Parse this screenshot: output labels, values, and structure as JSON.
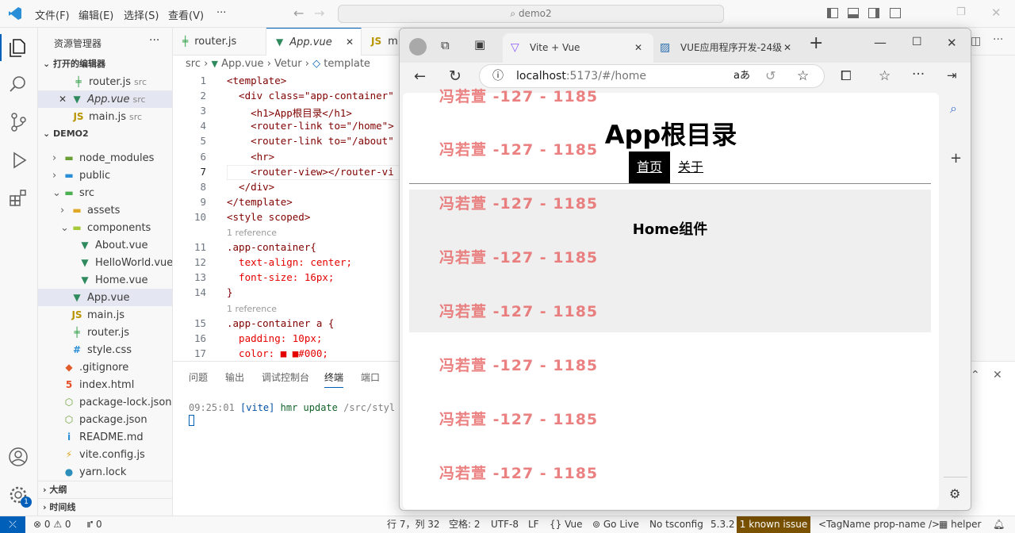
{
  "menu": {
    "file": "文件(F)",
    "edit": "编辑(E)",
    "select": "选择(S)",
    "view": "查看(V)",
    "more": "···"
  },
  "search": {
    "text": "demo2"
  },
  "sidebar": {
    "title": "资源管理器",
    "more": "···",
    "open_editors": "打开的编辑器",
    "open_files": [
      {
        "name": "router.js",
        "hint": "src",
        "icon": "╪",
        "color": "#2f9e44"
      },
      {
        "name": "App.vue",
        "hint": "src",
        "icon": "▼",
        "color": "#2f8a5d",
        "italic": true,
        "close": "✕"
      },
      {
        "name": "main.js",
        "hint": "src",
        "icon": "JS",
        "color": "#b89500"
      }
    ],
    "project": "DEMO2",
    "tree": [
      {
        "name": "node_modules",
        "depth": 1,
        "arrow": "›",
        "icon": "▬",
        "color": "#6a9f36"
      },
      {
        "name": "public",
        "depth": 1,
        "arrow": "›",
        "icon": "▬",
        "color": "#2a8fd6"
      },
      {
        "name": "src",
        "depth": 1,
        "arrow": "⌄",
        "icon": "▬",
        "color": "#4caf50"
      },
      {
        "name": "assets",
        "depth": 2,
        "arrow": "›",
        "icon": "▬",
        "color": "#e0a826"
      },
      {
        "name": "components",
        "depth": 2,
        "arrow": "⌄",
        "icon": "▬",
        "color": "#a6c93a"
      },
      {
        "name": "About.vue",
        "depth": 3,
        "arrow": "",
        "icon": "▼",
        "color": "#2f8a5d"
      },
      {
        "name": "HelloWorld.vue",
        "depth": 3,
        "arrow": "",
        "icon": "▼",
        "color": "#2f8a5d"
      },
      {
        "name": "Home.vue",
        "depth": 3,
        "arrow": "",
        "icon": "▼",
        "color": "#2f8a5d"
      },
      {
        "name": "App.vue",
        "depth": 2,
        "arrow": "",
        "icon": "▼",
        "color": "#2f8a5d",
        "selected": true
      },
      {
        "name": "main.js",
        "depth": 2,
        "arrow": "",
        "icon": "JS",
        "color": "#b89500"
      },
      {
        "name": "router.js",
        "depth": 2,
        "arrow": "",
        "icon": "╪",
        "color": "#2f9e44"
      },
      {
        "name": "style.css",
        "depth": 2,
        "arrow": "",
        "icon": "#",
        "color": "#2a8fd6"
      },
      {
        "name": ".gitignore",
        "depth": 1,
        "arrow": "",
        "icon": "◆",
        "color": "#e05d2b"
      },
      {
        "name": "index.html",
        "depth": 1,
        "arrow": "",
        "icon": "5",
        "color": "#e44d26"
      },
      {
        "name": "package-lock.json",
        "depth": 1,
        "arrow": "",
        "icon": "⬡",
        "color": "#6a9f36"
      },
      {
        "name": "package.json",
        "depth": 1,
        "arrow": "",
        "icon": "⬡",
        "color": "#6a9f36"
      },
      {
        "name": "README.md",
        "depth": 1,
        "arrow": "",
        "icon": "i",
        "color": "#2a8fd6"
      },
      {
        "name": "vite.config.js",
        "depth": 1,
        "arrow": "",
        "icon": "⚡",
        "color": "#e0a826"
      },
      {
        "name": "yarn.lock",
        "depth": 1,
        "arrow": "",
        "icon": "●",
        "color": "#2c8ebb"
      }
    ],
    "outline": "大纲",
    "timeline": "时间线"
  },
  "tabs": [
    {
      "name": "router.js",
      "icon": "╪",
      "color": "#2f9e44"
    },
    {
      "name": "App.vue",
      "icon": "▼",
      "color": "#2f8a5d",
      "close": "✕",
      "active": true
    },
    {
      "name": "m",
      "icon": "JS",
      "color": "#b89500"
    }
  ],
  "breadcrumb": {
    "src": "src",
    "sep": "›",
    "file": "App.vue",
    "vetur": "Vetur",
    "template": "template"
  },
  "code": [
    {
      "ln": "1",
      "text": "<template>"
    },
    {
      "ln": "2",
      "text": "  <div class=\"app-container\""
    },
    {
      "ln": "3",
      "text": "    <h1>App根目录</h1>"
    },
    {
      "ln": "4",
      "text": "    <router-link to=\"/home\">"
    },
    {
      "ln": "5",
      "text": "    <router-link to=\"/about\""
    },
    {
      "ln": "6",
      "text": "    <hr>"
    },
    {
      "ln": "7",
      "text": "    <router-view></router-vi"
    },
    {
      "ln": "8",
      "text": "  </div>"
    },
    {
      "ln": "9",
      "text": "</template>"
    },
    {
      "ln": "10",
      "text": "<style scoped>"
    },
    {
      "ref": "1 reference"
    },
    {
      "ln": "11",
      "text": ".app-container{"
    },
    {
      "ln": "12",
      "text": "  text-align: center;"
    },
    {
      "ln": "13",
      "text": "  font-size: 16px;"
    },
    {
      "ln": "14",
      "text": "}"
    },
    {
      "ref": "1 reference"
    },
    {
      "ln": "15",
      "text": ".app-container a {"
    },
    {
      "ln": "16",
      "text": "  padding: 10px;"
    },
    {
      "ln": "17",
      "text": "  color: ■ ■#000;"
    }
  ],
  "panel": {
    "tabs": [
      "问题",
      "输出",
      "调试控制台",
      "终端",
      "端口"
    ],
    "active": "终端",
    "line_time": "09:25:01",
    "line_tag": "[vite]",
    "line_msg": "hmr update",
    "line_path": "/src/styl"
  },
  "status": {
    "errors": "⊗ 0 ⚠ 0",
    "ports": "⑈ 0",
    "position": "行 7，列 32",
    "spaces": "空格: 2",
    "encoding": "UTF-8",
    "eol": "LF",
    "lang": "{} Vue",
    "golive": "Go Live",
    "tsconfig": "No tsconfig",
    "version": "5.3.2",
    "issue": "1 known issue",
    "tagname": "<TagName prop-name />",
    "helper": "helper"
  },
  "browser": {
    "tab1": "Vite + Vue",
    "tab2": "VUE应用程序开发-24级",
    "tab_close": "✕",
    "new_tab": "+",
    "url_host": "localhost",
    "url_rest": ":5173/#/home",
    "read_aloud": "aあ",
    "page": {
      "h1": "App根目录",
      "nav_home": "首页",
      "nav_about": "关于",
      "home_comp": "Home组件"
    },
    "watermark": "冯若萱 -127 - 1185"
  },
  "colors": {
    "accent": "#005fb8",
    "watermark": "#e76a6a",
    "issue_bg": "#7a5200"
  }
}
